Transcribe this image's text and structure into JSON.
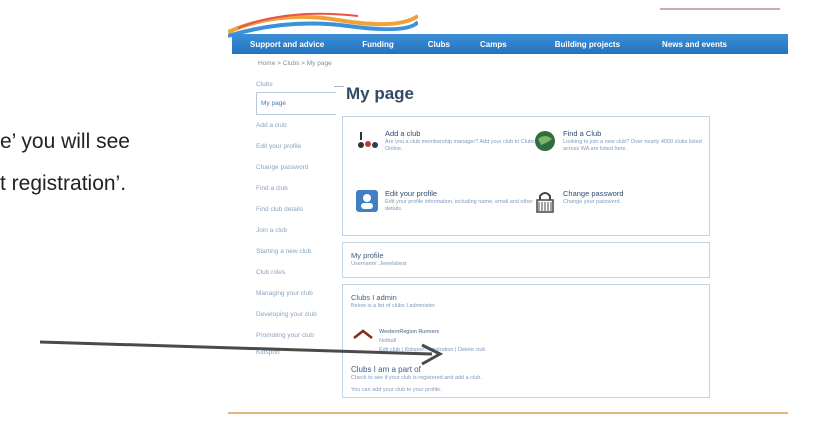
{
  "doc": {
    "line1": "e’ you will see",
    "line2": "t registration’."
  },
  "nav": {
    "items": [
      "Support and advice",
      "Funding",
      "Clubs",
      "Camps",
      "Building projects",
      "News and events"
    ]
  },
  "breadcrumb": "Home  >  Clubs  >  My page",
  "sidebar": {
    "items": [
      "Clubs",
      "My page",
      "Add a club",
      "Edit your profile",
      "Change password",
      "Find a club",
      "Find club details",
      "Join a club",
      "Starting a new club",
      "Club roles",
      "Managing your club",
      "Developing your club",
      "Promoting your club",
      "Kidsport"
    ]
  },
  "page_title": "My page",
  "tiles": {
    "add": {
      "title": "Add a club",
      "desc": "Are you a club membership manager? Add your club to Clubs Online."
    },
    "find": {
      "title": "Find a Club",
      "desc": "Looking to join a new club? Over nearly 4000 clubs listed across WA are listed here."
    },
    "edit": {
      "title": "Edit your profile",
      "desc": "Edit your profile information, including name, email and other details."
    },
    "password": {
      "title": "Change password",
      "desc": "Change your password."
    }
  },
  "profile": {
    "heading": "My profile",
    "sub": "Username: Jewelsbest"
  },
  "clubs": {
    "heading": "Clubs I admin",
    "sub": "Below is a list of clubs I administer.",
    "club_name": "WesternRegion Runners",
    "club_type": "Netball",
    "club_links": "Edit club  |  Kidsport registration  |  Delete club"
  },
  "partof": {
    "heading": "Clubs I am a part of",
    "sub": "Check to see if your club is registered and add a club.",
    "note": "You can add your club to your profile."
  },
  "colors": {
    "nav": "#2372be",
    "accent_underline": "#e2b37a",
    "arrow": "#4a4a4a"
  }
}
